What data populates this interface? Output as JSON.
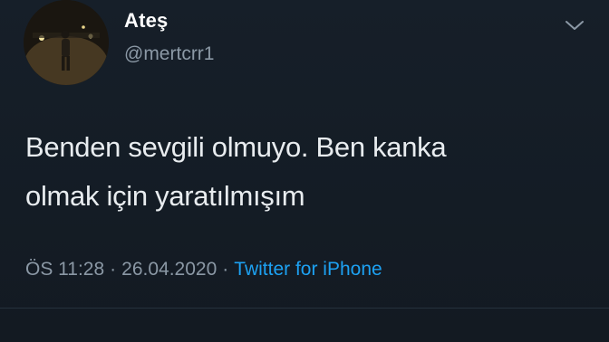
{
  "user": {
    "display_name": "Ateş",
    "handle": "@mertcrr1"
  },
  "tweet": {
    "text_line_1": "Benden sevgili olmuyo. Ben kanka",
    "text_line_2": "olmak için yaratılmışım"
  },
  "meta": {
    "time": "ÖS 11:28",
    "separator": "·",
    "date": "26.04.2020",
    "source": "Twitter for iPhone"
  },
  "icons": {
    "menu": "chevron-down-icon"
  },
  "colors": {
    "background": "#141d26",
    "secondary_text": "#8b98a5",
    "link": "#1da1f2"
  }
}
